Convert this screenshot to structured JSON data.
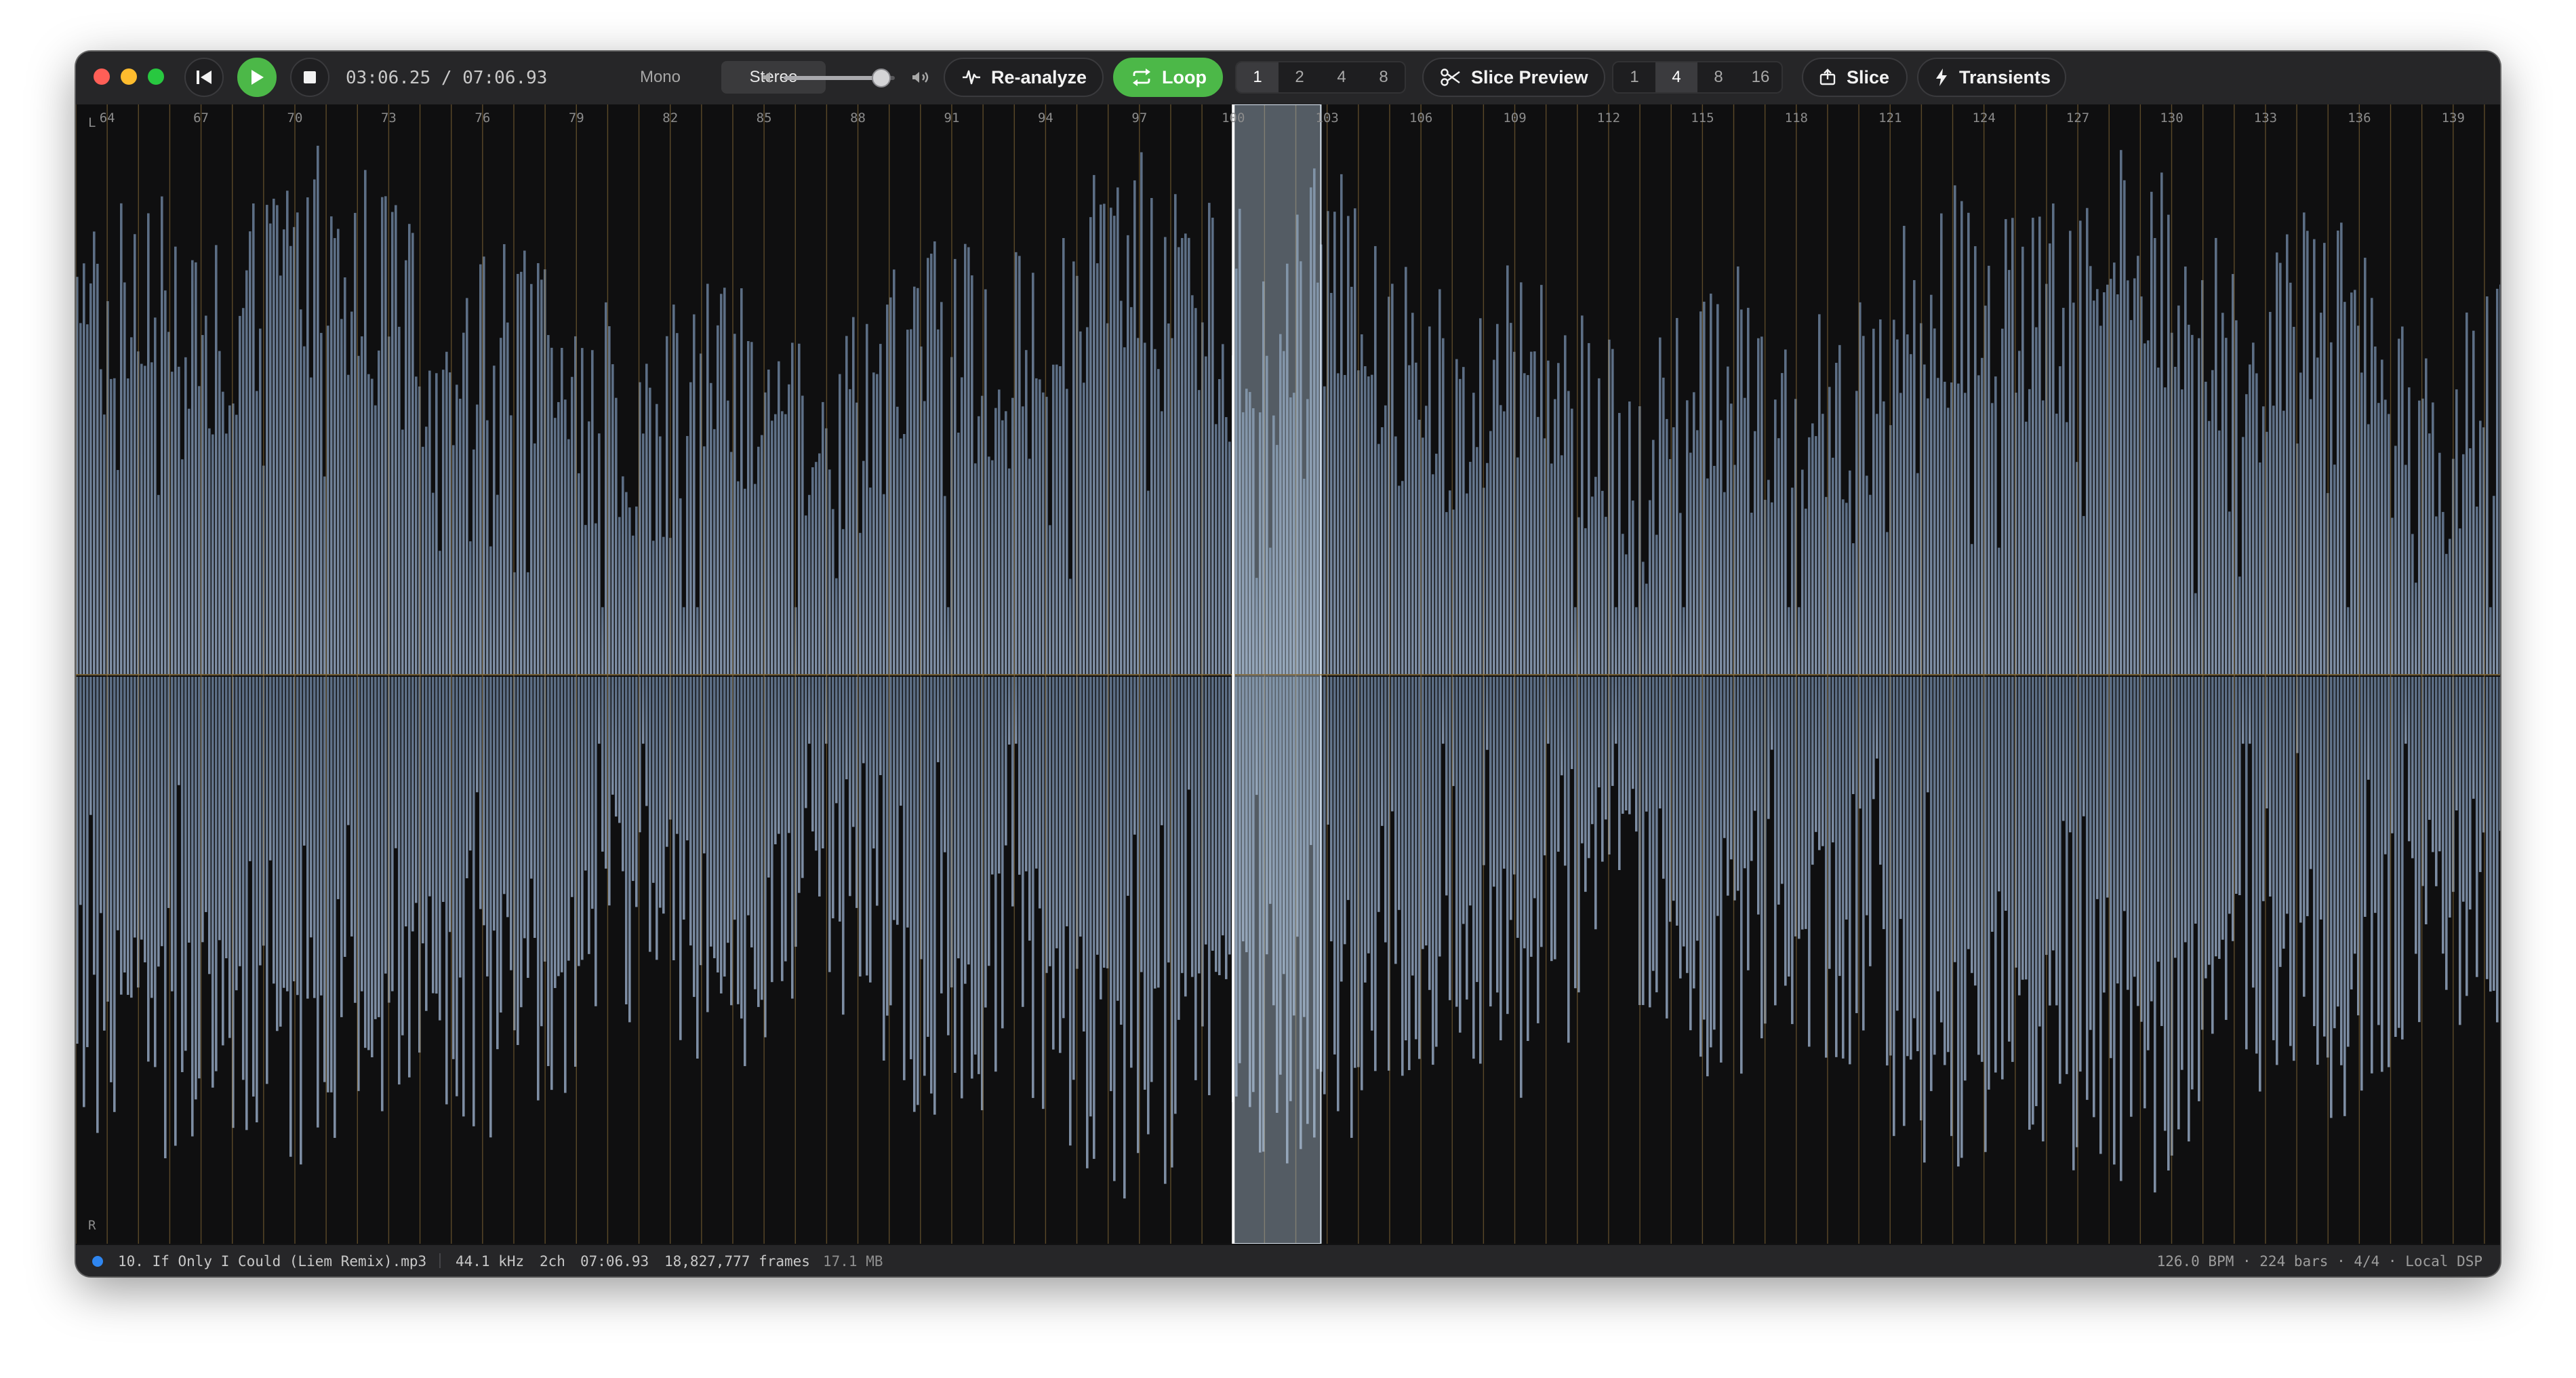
{
  "transport": {
    "time_current": "03:06.25",
    "time_separator": "/",
    "time_total": "07:06.93",
    "is_playing": false
  },
  "channel_mode": {
    "options": [
      "Mono",
      "Stereo"
    ],
    "selected": "Stereo"
  },
  "volume": {
    "level": 0.88
  },
  "toolbar": {
    "reanalyze_label": "Re-analyze",
    "loop_label": "Loop",
    "loop_active": true,
    "loop_lengths": [
      "1",
      "2",
      "4",
      "8"
    ],
    "slice_preview_label": "Slice Preview",
    "slice_divisions": [
      "1",
      "4",
      "8",
      "16"
    ],
    "slice_division_selected": "4",
    "slice_label": "Slice",
    "transients_label": "Transients"
  },
  "waveform": {
    "channel_top_label": "L",
    "channel_bottom_label": "R",
    "bar_ruler": [
      "64",
      "67",
      "70",
      "73",
      "76",
      "79",
      "82",
      "85",
      "88",
      "91",
      "94",
      "97",
      "100",
      "103",
      "106",
      "109",
      "112",
      "115",
      "118",
      "121",
      "124",
      "127",
      "130",
      "133",
      "136",
      "139"
    ],
    "visible_bars_start": 63,
    "visible_bars_end": 140.5,
    "selection_start_bar": 100,
    "selection_end_bar": 102.8,
    "playhead_bar": 100,
    "colors": {
      "background": "#0f0f10",
      "wave_top": "#5b6d84",
      "wave_bottom": "#7e8ea4",
      "selection": "#b6c7da",
      "grid": "#9a7a3e",
      "playhead": "#ffffff"
    }
  },
  "status": {
    "file_name": "10. If Only I Could (Liem Remix).mp3",
    "sample_rate": "44.1 kHz",
    "channels": "2ch",
    "duration": "07:06.93",
    "frames": "18,827,777 frames",
    "size": "17.1 MB",
    "summary": "126.0 BPM · 224 bars · 4/4 · Local DSP"
  }
}
